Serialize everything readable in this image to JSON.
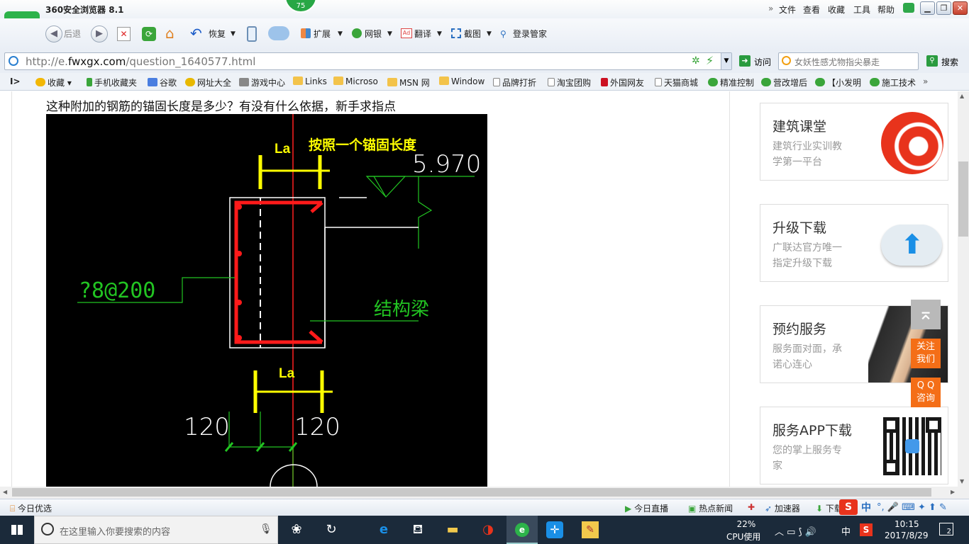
{
  "window": {
    "title": "360安全浏览器 8.1",
    "badge": "75",
    "menu": [
      "文件",
      "查看",
      "收藏",
      "工具",
      "帮助"
    ]
  },
  "toolbar": {
    "back": "后退",
    "restore": "恢复",
    "extend": "扩展",
    "netbank": "网银",
    "translate": "翻译",
    "screenshot": "截图",
    "login": "登录管家"
  },
  "address": {
    "url_prefix": "http://e.",
    "url_domain": "fwxgx.com",
    "url_path": "/question_1640577.html",
    "visit": "访问",
    "search_placeholder": "女妖性感尤物指尖暴走",
    "search_button": "搜索"
  },
  "favorites": [
    "收藏",
    "手机收藏夹",
    "谷歌",
    "网址大全",
    "游戏中心",
    "Links",
    "Microso",
    "MSN 网",
    "Window",
    "品牌打折",
    "淘宝团购",
    "外国网友",
    "天猫商城",
    "精准控制",
    "营改增后",
    "【小发明",
    "施工技术"
  ],
  "page": {
    "question": "这种附加的钢筋的锚固长度是多少？有没有什么依据，新手求指点",
    "drawing": {
      "label_la_top": "La",
      "note": "按照一个锚固长度",
      "elevation": "5.970",
      "stirrup": "?8@200",
      "beam": "结构梁",
      "label_la_bottom": "La",
      "dim_left": "120",
      "dim_right": "120"
    }
  },
  "sidebar": {
    "cards": [
      {
        "title": "建筑课堂",
        "desc1": "建筑行业实训教",
        "desc2": "学第一平台",
        "icon": "swirl-logo-icon"
      },
      {
        "title": "升级下载",
        "desc1": "广联达官方唯一",
        "desc2": "指定升级下载",
        "icon": "cloud-upload-icon"
      },
      {
        "title": "预约服务",
        "desc1": "服务面对面，承",
        "desc2": "诺心连心",
        "icon": "handshake-photo"
      },
      {
        "title": "服务APP下载",
        "desc1": "您的掌上服务专",
        "desc2": "家",
        "icon": "qr-code-icon"
      }
    ],
    "follow": [
      "关注",
      "我们"
    ],
    "qq": [
      "Q Q",
      "咨询"
    ]
  },
  "status": {
    "today_pick": "今日优选",
    "live": "今日直播",
    "hot_news": "热点新闻",
    "accelerator": "加速器",
    "download": "下载",
    "ime": "中"
  },
  "taskbar": {
    "search_placeholder": "在这里输入你要搜索的内容",
    "cpu_percent": "22%",
    "cpu_label": "CPU使用",
    "lang": "中",
    "time": "10:15",
    "date": "2017/8/29",
    "notifications": "2"
  },
  "colors": {
    "accent_green": "#2db34a",
    "orange": "#f46e17",
    "cad_red": "#ff1a1a",
    "cad_green": "#22c422",
    "cad_yellow": "#ffff00"
  }
}
